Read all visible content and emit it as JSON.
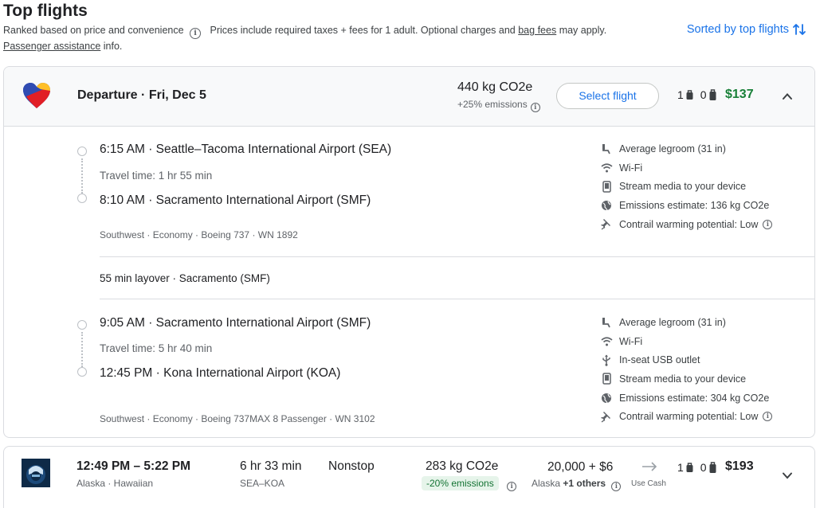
{
  "header": {
    "title": "Top flights",
    "ranked_text": "Ranked based on price and convenience",
    "prices_text_prefix": "Prices include required taxes + fees for 1 adult. Optional charges and",
    "bag_fees_link": "bag fees",
    "prices_text_suffix": "may apply.",
    "passenger_link": "Passenger assistance",
    "passenger_suffix": "info.",
    "sorted_label": "Sorted by top flights"
  },
  "selected_flight": {
    "departure_label": "Departure",
    "date": "Fri, Dec 5",
    "co2": "440 kg CO2e",
    "emissions_delta": "+25% emissions",
    "select_button": "Select flight",
    "carry_on_count": "1",
    "checked_count": "0",
    "price": "$137",
    "price_color": "#188038",
    "segments": [
      {
        "depart_time": "6:15 AM",
        "depart_airport": "Seattle–Tacoma International Airport (SEA)",
        "travel_time": "Travel time: 1 hr 55 min",
        "arrive_time": "8:10 AM",
        "arrive_airport": "Sacramento International Airport (SMF)",
        "details": "Southwest · Economy · Boeing 737 · WN 1892",
        "amenities": [
          {
            "icon": "legroom-icon",
            "text": "Average legroom (31 in)"
          },
          {
            "icon": "wifi-icon",
            "text": "Wi-Fi"
          },
          {
            "icon": "phone-stream-icon",
            "text": "Stream media to your device"
          },
          {
            "icon": "globe-icon",
            "text": "Emissions estimate: 136 kg CO2e"
          },
          {
            "icon": "contrail-icon",
            "text": "Contrail warming potential: Low"
          }
        ]
      },
      {
        "depart_time": "9:05 AM",
        "depart_airport": "Sacramento International Airport (SMF)",
        "travel_time": "Travel time: 5 hr 40 min",
        "arrive_time": "12:45 PM",
        "arrive_airport": "Kona International Airport (KOA)",
        "details": "Southwest · Economy · Boeing 737MAX 8 Passenger · WN 3102",
        "amenities": [
          {
            "icon": "legroom-icon",
            "text": "Average legroom (31 in)"
          },
          {
            "icon": "wifi-icon",
            "text": "Wi-Fi"
          },
          {
            "icon": "usb-icon",
            "text": "In-seat USB outlet"
          },
          {
            "icon": "phone-stream-icon",
            "text": "Stream media to your device"
          },
          {
            "icon": "globe-icon",
            "text": "Emissions estimate: 304 kg CO2e"
          },
          {
            "icon": "contrail-icon",
            "text": "Contrail warming potential: Low"
          }
        ]
      }
    ],
    "layover": "55 min layover · Sacramento (SMF)"
  },
  "next_flight": {
    "times": "12:49 PM – 5:22 PM",
    "airlines": "Alaska · Hawaiian",
    "duration": "6 hr 33 min",
    "route": "SEA–KOA",
    "stops": "Nonstop",
    "co2": "283 kg CO2e",
    "emissions_badge": "-20% emissions",
    "points": "20,000 + $6",
    "points_airline_prefix": "Alaska",
    "points_airline_bold": "+1 others",
    "use_cash": "Use Cash",
    "carry_on_count": "1",
    "checked_count": "0",
    "price": "$193"
  },
  "colors": {
    "accent": "#1a73e8",
    "price_green": "#188038",
    "badge_bg": "#e6f4ea"
  }
}
